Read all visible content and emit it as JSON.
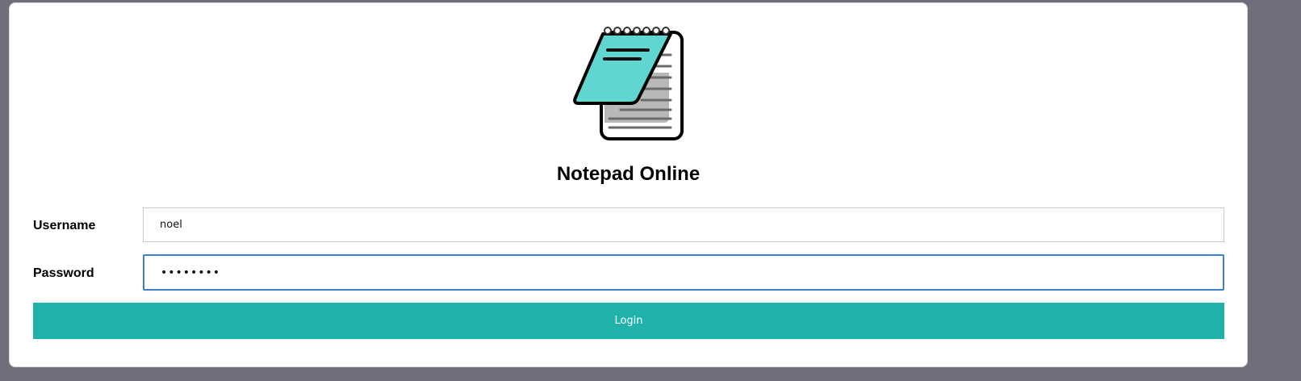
{
  "app": {
    "title": "Notepad Online"
  },
  "logo": {
    "icon": "notepad-icon",
    "colors": {
      "cover": "#5fd6d2",
      "paper": "#ffffff",
      "shadow": "#b8b8b8",
      "lines": "#6b6b6b",
      "outline": "#000000"
    }
  },
  "form": {
    "username": {
      "label": "Username",
      "value": "noel"
    },
    "password": {
      "label": "Password",
      "value": "••••••••"
    },
    "login_label": "Login"
  },
  "colors": {
    "accent": "#20b2aa",
    "focus_border": "#3d7fd1",
    "backdrop": "#6f6f7b"
  }
}
